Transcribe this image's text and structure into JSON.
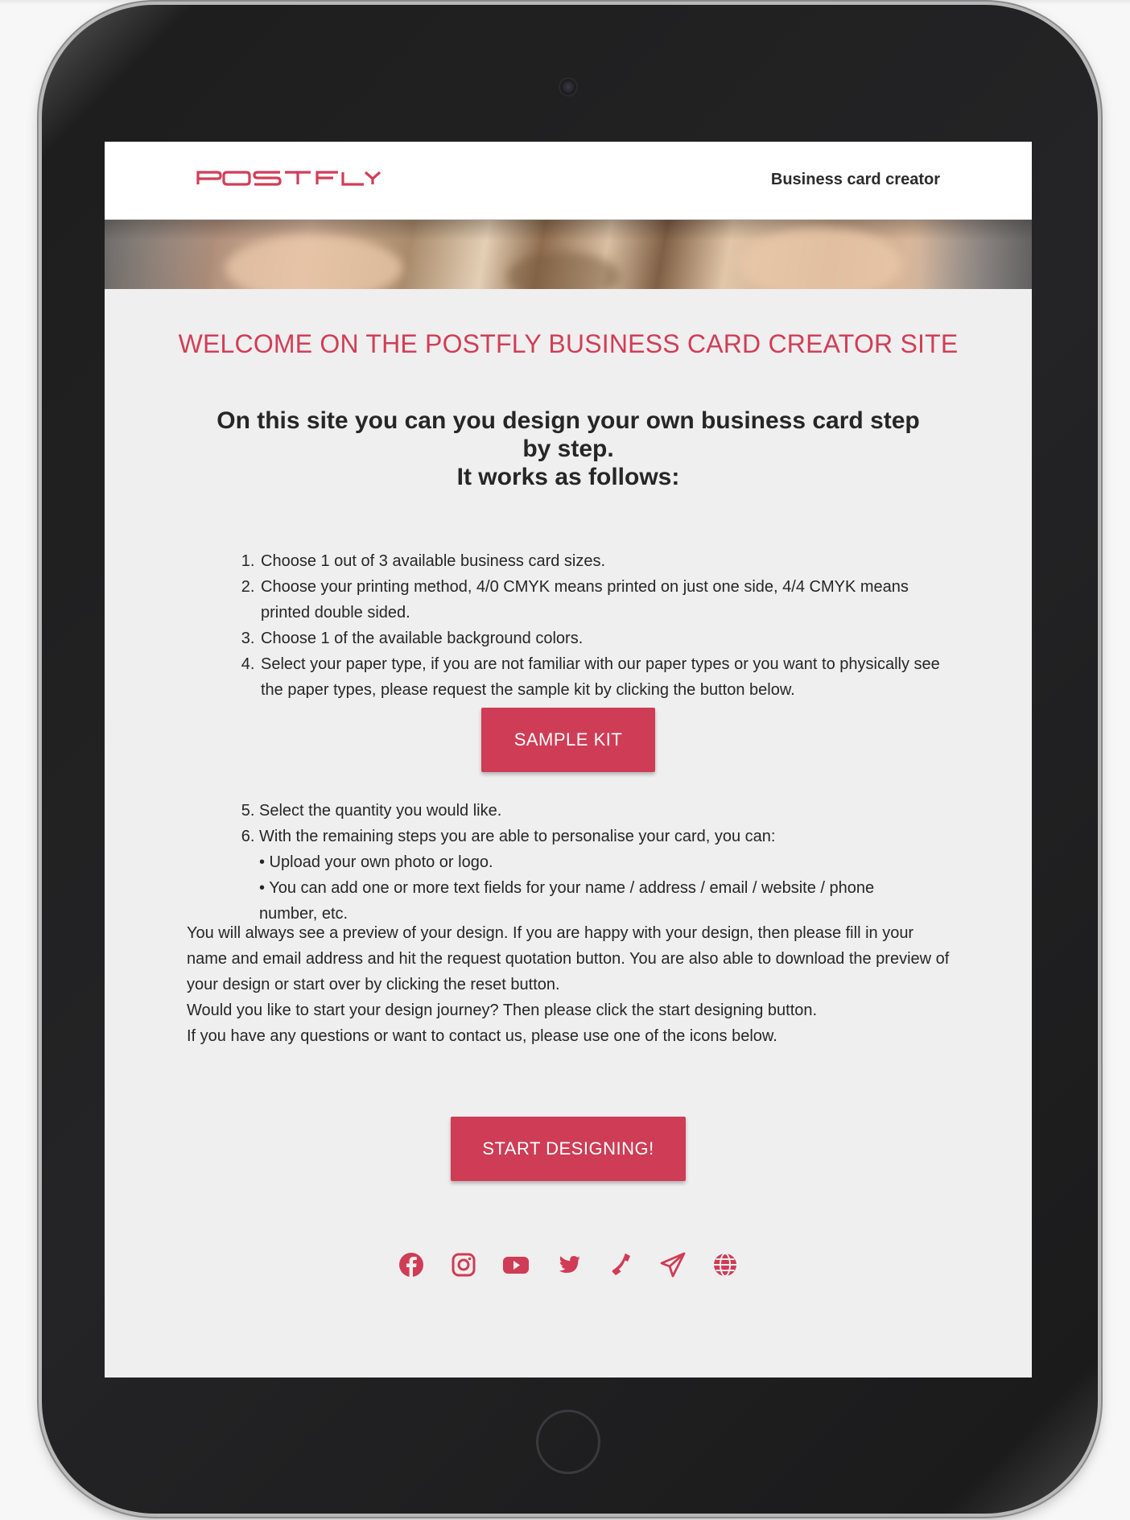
{
  "header": {
    "logo_text": "POSTFLY",
    "nav_link": "Business card creator"
  },
  "main": {
    "welcome_title": "WELCOME ON THE POSTFLY BUSINESS CARD CREATOR SITE",
    "intro_line1": "On this site you can you design your own business card step by step.",
    "intro_line2": "It works as follows:",
    "steps": [
      "Choose 1 out of 3 available business card sizes.",
      "Choose your printing method, 4/0 CMYK means printed on just one side, 4/4 CMYK means printed double sided.",
      "Choose 1 of the available background colors.",
      "Select your paper type, if you are not familiar with our paper types or you want to physically see the paper types, please request the sample kit by clicking the button below."
    ],
    "sample_kit_button": "SAMPLE KIT",
    "steps_continued": [
      "Select the quantity you would like.",
      "With the remaining steps you are able to personalise your card, you can:"
    ],
    "personalise_options": [
      "• Upload your own photo or logo.",
      "• You can add one or more text fields for your name / address / email / website / phone number, etc."
    ],
    "paragraphs": [
      "You will always see a preview of your design. If you are happy with your design, then please fill in your name and email address and hit the request quotation button. You are also able to download the preview of your design or start over by clicking the reset button.",
      "Would you like to start your design journey? Then please click the start designing button.",
      "If you have any questions or want to contact us, please use one of the icons below."
    ],
    "start_button": "START DESIGNING!"
  },
  "social_icons": [
    "facebook-icon",
    "instagram-icon",
    "youtube-icon",
    "twitter-icon",
    "phone-icon",
    "send-icon",
    "globe-icon"
  ],
  "colors": {
    "accent": "#cf3c55",
    "background": "#efefef",
    "header_bg": "#ffffff",
    "text": "#262626"
  }
}
